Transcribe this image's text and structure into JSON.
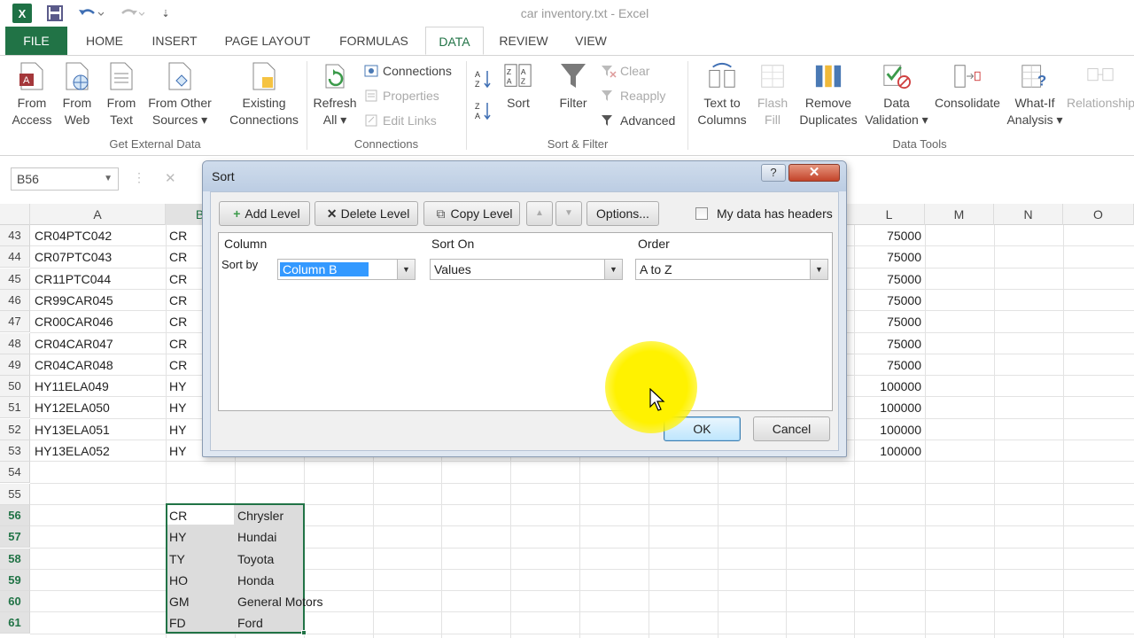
{
  "window": {
    "title": "car inventory.txt - Excel"
  },
  "quick_access": {
    "app_icon": "excel-logo-icon",
    "icons": [
      "save-icon",
      "undo-icon",
      "redo-icon",
      "customize-qat-icon"
    ]
  },
  "ribbon_tabs": [
    "FILE",
    "HOME",
    "INSERT",
    "PAGE LAYOUT",
    "FORMULAS",
    "DATA",
    "REVIEW",
    "VIEW"
  ],
  "active_tab": "DATA",
  "ribbon": {
    "get_external_data": {
      "label": "Get External Data",
      "from_access": [
        "From",
        "Access"
      ],
      "from_web": [
        "From",
        "Web"
      ],
      "from_text": [
        "From",
        "Text"
      ],
      "from_other": [
        "From Other",
        "Sources ▾"
      ],
      "existing": [
        "Existing",
        "Connections"
      ]
    },
    "connections": {
      "label": "Connections",
      "refresh": [
        "Refresh",
        "All ▾"
      ],
      "connections": "Connections",
      "properties": "Properties",
      "edit_links": "Edit Links"
    },
    "sort_filter": {
      "label": "Sort & Filter",
      "sort": "Sort",
      "filter": "Filter",
      "clear": "Clear",
      "reapply": "Reapply",
      "advanced": "Advanced"
    },
    "data_tools": {
      "label": "Data Tools",
      "text_to_columns": [
        "Text to",
        "Columns"
      ],
      "flash_fill": [
        "Flash",
        "Fill"
      ],
      "remove_duplicates": [
        "Remove",
        "Duplicates"
      ],
      "data_validation": [
        "Data",
        "Validation ▾"
      ],
      "consolidate": "Consolidate",
      "what_if": [
        "What-If",
        "Analysis ▾"
      ],
      "relationships": "Relationships"
    }
  },
  "formula_bar": {
    "name_box": "B56",
    "cancel": "✕"
  },
  "columns": [
    "A",
    "B",
    "L",
    "M",
    "N",
    "O"
  ],
  "rows": [
    {
      "num": "43",
      "a": "CR04PTC042",
      "b": "CR",
      "l": "75000"
    },
    {
      "num": "44",
      "a": "CR07PTC043",
      "b": "CR",
      "l": "75000"
    },
    {
      "num": "45",
      "a": "CR11PTC044",
      "b": "CR",
      "l": "75000"
    },
    {
      "num": "46",
      "a": "CR99CAR045",
      "b": "CR",
      "l": "75000"
    },
    {
      "num": "47",
      "a": "CR00CAR046",
      "b": "CR",
      "l": "75000"
    },
    {
      "num": "48",
      "a": "CR04CAR047",
      "b": "CR",
      "l": "75000"
    },
    {
      "num": "49",
      "a": "CR04CAR048",
      "b": "CR",
      "l": "75000"
    },
    {
      "num": "50",
      "a": "HY11ELA049",
      "b": "HY",
      "l": "100000"
    },
    {
      "num": "51",
      "a": "HY12ELA050",
      "b": "HY",
      "l": "100000"
    },
    {
      "num": "52",
      "a": "HY13ELA051",
      "b": "HY",
      "l": "100000"
    },
    {
      "num": "53",
      "a": "HY13ELA052",
      "b": "HY",
      "l": "100000"
    },
    {
      "num": "54",
      "a": "",
      "b": "",
      "l": ""
    },
    {
      "num": "55",
      "a": "",
      "b": "",
      "l": ""
    },
    {
      "num": "56",
      "a": "",
      "b": "CR",
      "c": "Chrysler",
      "l": ""
    },
    {
      "num": "57",
      "a": "",
      "b": "HY",
      "c": "Hundai",
      "l": ""
    },
    {
      "num": "58",
      "a": "",
      "b": "TY",
      "c": "Toyota",
      "l": ""
    },
    {
      "num": "59",
      "a": "",
      "b": "HO",
      "c": "Honda",
      "l": ""
    },
    {
      "num": "60",
      "a": "",
      "b": "GM",
      "c": "General Motors",
      "l": ""
    },
    {
      "num": "61",
      "a": "",
      "b": "FD",
      "c": "Ford",
      "l": ""
    }
  ],
  "dialog": {
    "title": "Sort",
    "help": "?",
    "close": "✕",
    "add_level": "Add Level",
    "delete_level": "Delete Level",
    "copy_level": "Copy Level",
    "move_up": "▲",
    "move_down": "▼",
    "options": "Options...",
    "headers_checkbox": "My data has headers",
    "headers_checked": false,
    "col_header": "Column",
    "sort_on_header": "Sort On",
    "order_header": "Order",
    "sort_by_label": "Sort by",
    "column_value": "Column B",
    "sort_on_value": "Values",
    "order_value": "A to Z",
    "ok": "OK",
    "cancel": "Cancel"
  },
  "colors": {
    "excel_green": "#217346",
    "dialog_bg": "#f0f0f0",
    "highlight": "#3399ff",
    "cursor_spotlight": "#fff200"
  }
}
